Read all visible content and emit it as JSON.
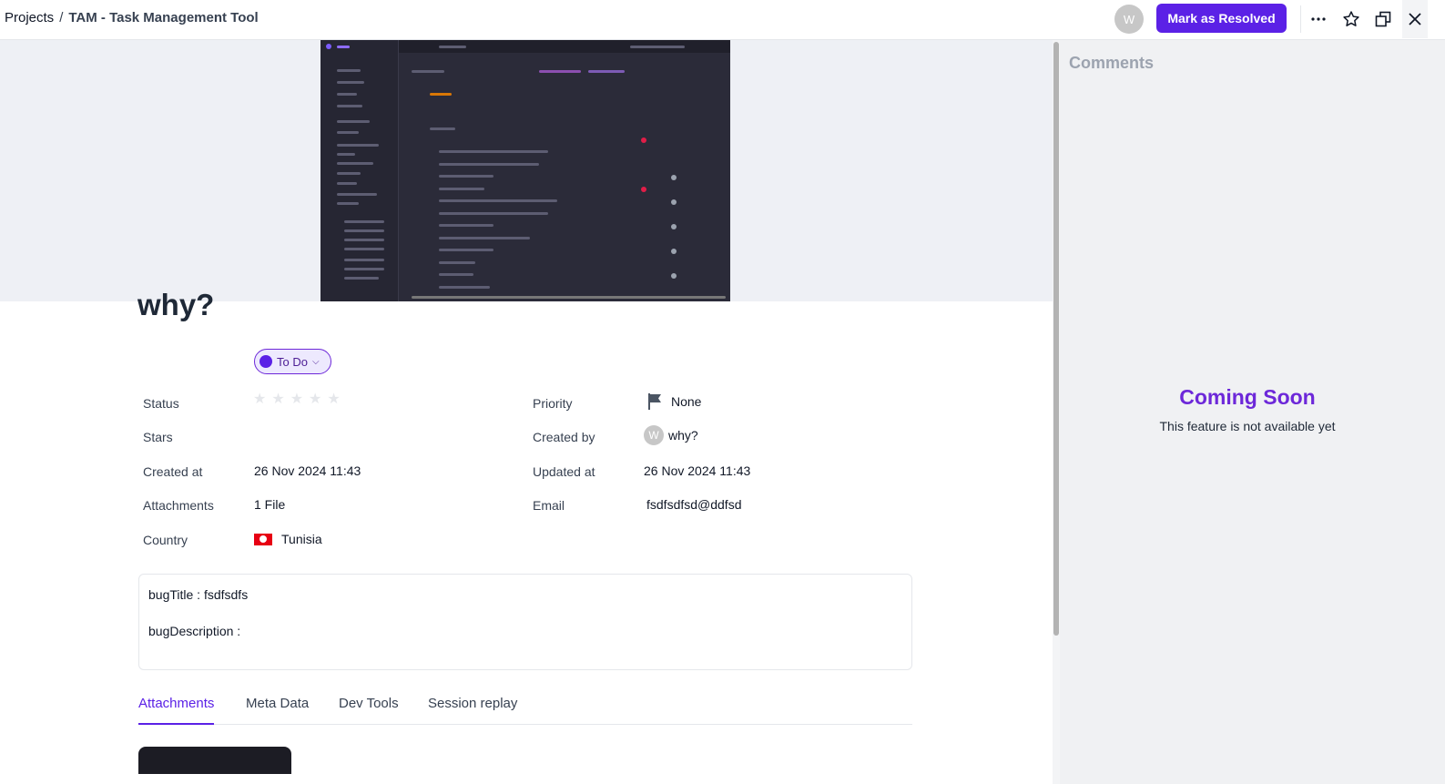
{
  "header": {
    "breadcrumb_root": "Projects",
    "breadcrumb_separator": "/",
    "breadcrumb_current": "TAM - Task Management Tool",
    "avatar_initial": "W",
    "resolve_label": "Mark as Resolved",
    "more_icon": "more-horizontal-icon",
    "star_icon": "star-icon",
    "popout_icon": "popout-window-icon",
    "close_icon": "close-icon"
  },
  "task": {
    "title": "why?",
    "fields_left": {
      "status_label": "Status",
      "status_value": "To Do",
      "stars_label": "Stars",
      "stars_rating": 0,
      "stars_max": 5,
      "created_at_label": "Created at",
      "created_at_value": "26 Nov 2024 11:43",
      "attachments_label": "Attachments",
      "attachments_value": "1 File",
      "country_label": "Country",
      "country_value": "Tunisia"
    },
    "fields_right": {
      "priority_label": "Priority",
      "priority_value": "None",
      "created_by_label": "Created by",
      "created_by_initial": "W",
      "created_by_value": "why?",
      "updated_at_label": "Updated at",
      "updated_at_value": "26 Nov 2024 11:43",
      "email_label": "Email",
      "email_value": "fsdfsdfsd@ddfsd"
    },
    "description": {
      "line1": "bugTitle : fsdfsdfs",
      "line2": "bugDescription :"
    },
    "tabs": [
      {
        "label": "Attachments",
        "active": true
      },
      {
        "label": "Meta Data",
        "active": false
      },
      {
        "label": "Dev Tools",
        "active": false
      },
      {
        "label": "Session replay",
        "active": false
      }
    ]
  },
  "comments": {
    "title": "Comments",
    "coming_soon": "Coming Soon",
    "coming_soon_sub": "This feature is not available yet"
  },
  "colors": {
    "accent": "#5b21e6",
    "status_bg": "#ede9fe",
    "panel_bg": "#f0f1f3"
  }
}
